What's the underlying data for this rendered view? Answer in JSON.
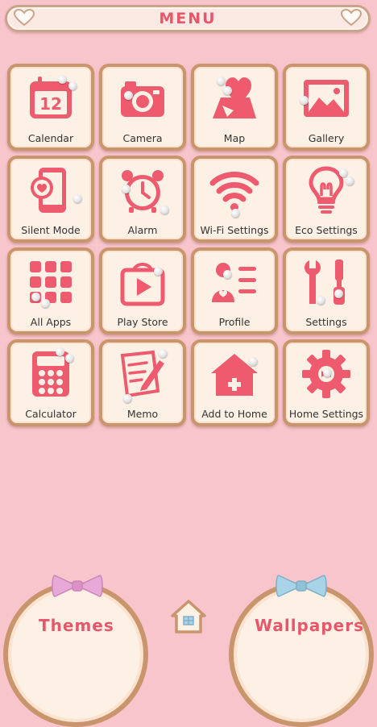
{
  "header": {
    "title": "MENU"
  },
  "tiles": [
    {
      "label": "Calendar",
      "icon": "calendar-icon",
      "day": "12"
    },
    {
      "label": "Camera",
      "icon": "camera-icon"
    },
    {
      "label": "Map",
      "icon": "map-icon"
    },
    {
      "label": "Gallery",
      "icon": "gallery-icon"
    },
    {
      "label": "Silent Mode",
      "icon": "silent-mode-icon"
    },
    {
      "label": "Alarm",
      "icon": "alarm-clock-icon"
    },
    {
      "label": "Wi-Fi Settings",
      "icon": "wifi-icon"
    },
    {
      "label": "Eco Settings",
      "icon": "lightbulb-icon"
    },
    {
      "label": "All Apps",
      "icon": "app-grid-icon"
    },
    {
      "label": "Play Store",
      "icon": "play-store-icon"
    },
    {
      "label": "Profile",
      "icon": "profile-icon"
    },
    {
      "label": "Settings",
      "icon": "tools-icon"
    },
    {
      "label": "Calculator",
      "icon": "calculator-icon"
    },
    {
      "label": "Memo",
      "icon": "memo-icon"
    },
    {
      "label": "Add to Home",
      "icon": "add-home-icon"
    },
    {
      "label": "Home Settings",
      "icon": "gear-icon"
    }
  ],
  "bottom": {
    "themes_label": "Themes",
    "wallpapers_label": "Wallpapers",
    "home_icon": "home-icon"
  },
  "colors": {
    "background": "#f8c5cc",
    "accent_pink": "#ee5a6e",
    "tile_face": "#fdf1e6",
    "tile_border": "#c9956c",
    "bow_pink": "#e9a9d8",
    "bow_blue": "#a9d3e6"
  }
}
